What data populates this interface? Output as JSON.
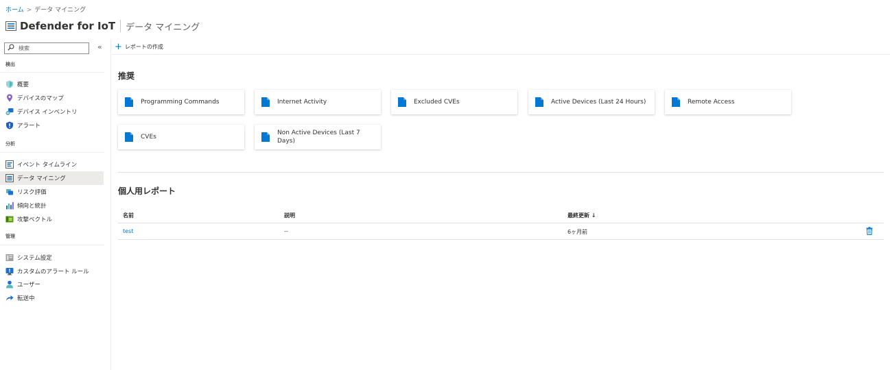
{
  "breadcrumb": {
    "home": "ホーム",
    "separator": ">",
    "current": "データ マイニング"
  },
  "header": {
    "title": "Defender for IoT",
    "subtitle": "データ マイニング"
  },
  "sidebar": {
    "search_placeholder": "検索",
    "collapse_icon": "«",
    "sections": [
      {
        "label": "検出",
        "items": [
          {
            "label": "概要",
            "icon": "shield-icon"
          },
          {
            "label": "デバイスのマップ",
            "icon": "map-pin-icon"
          },
          {
            "label": "デバイス インベントリ",
            "icon": "devices-icon"
          },
          {
            "label": "アラート",
            "icon": "alert-shield-icon"
          }
        ]
      },
      {
        "label": "分析",
        "items": [
          {
            "label": "イベント タイムライン",
            "icon": "timeline-icon"
          },
          {
            "label": "データ マイニング",
            "icon": "data-mining-icon",
            "active": true
          },
          {
            "label": "リスク評価",
            "icon": "risk-icon"
          },
          {
            "label": "傾向と統計",
            "icon": "bar-chart-icon"
          },
          {
            "label": "攻撃ベクトル",
            "icon": "attack-vector-icon"
          }
        ]
      },
      {
        "label": "管理",
        "items": [
          {
            "label": "システム設定",
            "icon": "system-settings-icon"
          },
          {
            "label": "カスタムのアラート ルール",
            "icon": "custom-rule-icon"
          },
          {
            "label": "ユーザー",
            "icon": "user-icon"
          },
          {
            "label": "転送中",
            "icon": "forward-arrow-icon"
          }
        ]
      }
    ]
  },
  "toolbar": {
    "create_label": "レポートの作成"
  },
  "recommended": {
    "heading": "推奨",
    "cards": [
      {
        "label": "Programming Commands"
      },
      {
        "label": "Internet Activity"
      },
      {
        "label": "Excluded CVEs"
      },
      {
        "label": "Active Devices (Last 24 Hours)"
      },
      {
        "label": "Remote Access"
      },
      {
        "label": "CVEs"
      },
      {
        "label": "Non Active Devices (Last 7 Days)"
      }
    ]
  },
  "personal": {
    "heading": "個人用レポート",
    "columns": {
      "name": "名前",
      "description": "説明",
      "updated": "最終更新 ↓"
    },
    "rows": [
      {
        "name": "test",
        "description": "--",
        "updated": "6ヶ月前"
      }
    ]
  },
  "colors": {
    "accent": "#0078d4",
    "doc_icon": "#0078d4",
    "active_nav": "#edebe9"
  }
}
